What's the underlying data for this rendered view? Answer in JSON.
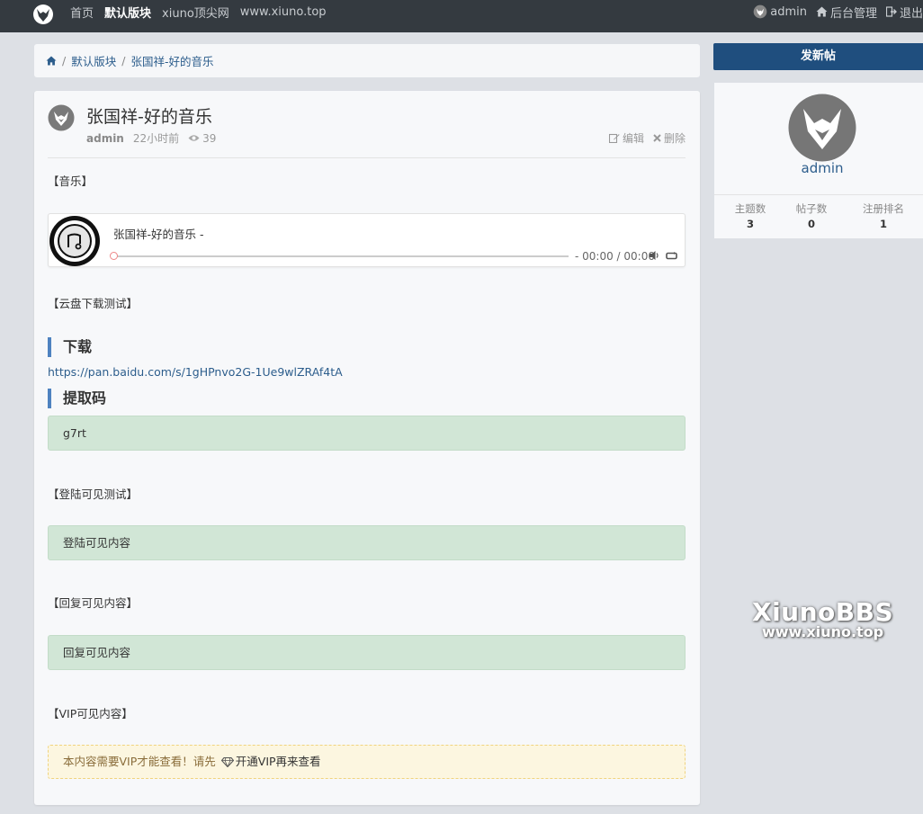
{
  "nav": {
    "links": [
      "首页",
      "默认版块",
      "xiuno顶尖网",
      "www.xiuno.top"
    ],
    "active_index": 1,
    "user": "admin",
    "admin": "后台管理",
    "logout": "退出"
  },
  "breadcrumb": {
    "forum": "默认版块",
    "thread": "张国祥-好的音乐"
  },
  "thread": {
    "title": "张国祥-好的音乐",
    "author": "admin",
    "time": "22小时前",
    "views": "39",
    "edit": "编辑",
    "delete": "删除"
  },
  "content": {
    "music_tag": "【音乐】",
    "player": {
      "title": "张国祥-好的音乐 -",
      "time": "- 00:00 / 00:00"
    },
    "cloud_tag": "【云盘下载测试】",
    "download_heading": "下载",
    "download_link": "https://pan.baidu.com/s/1gHPnvo2G-1Ue9wlZRAf4tA",
    "code_heading": "提取码",
    "code": "g7rt",
    "login_tag": "【登陆可见测试】",
    "login_box": "登陆可见内容",
    "reply_tag": "【回复可见内容】",
    "reply_box": "回复可见内容",
    "vip_tag": "【VIP可见内容】",
    "vip_prefix": "本内容需要VIP才能查看！请先",
    "vip_link": "开通VIP再来查看"
  },
  "sidebar": {
    "new_post": "发新帖",
    "username": "admin",
    "stats": [
      {
        "label": "主题数",
        "value": "3"
      },
      {
        "label": "帖子数",
        "value": "0"
      },
      {
        "label": "注册排名",
        "value": "1"
      }
    ]
  },
  "watermark": {
    "line1": "XiunoBBS",
    "line2": "www.xiuno.top"
  },
  "colors": {
    "nav_bg": "#343a40",
    "accent": "#1f4e7e",
    "link": "#2c5d8c",
    "success_box": "#d1e6d6",
    "warning_box": "#fcf6e0"
  }
}
